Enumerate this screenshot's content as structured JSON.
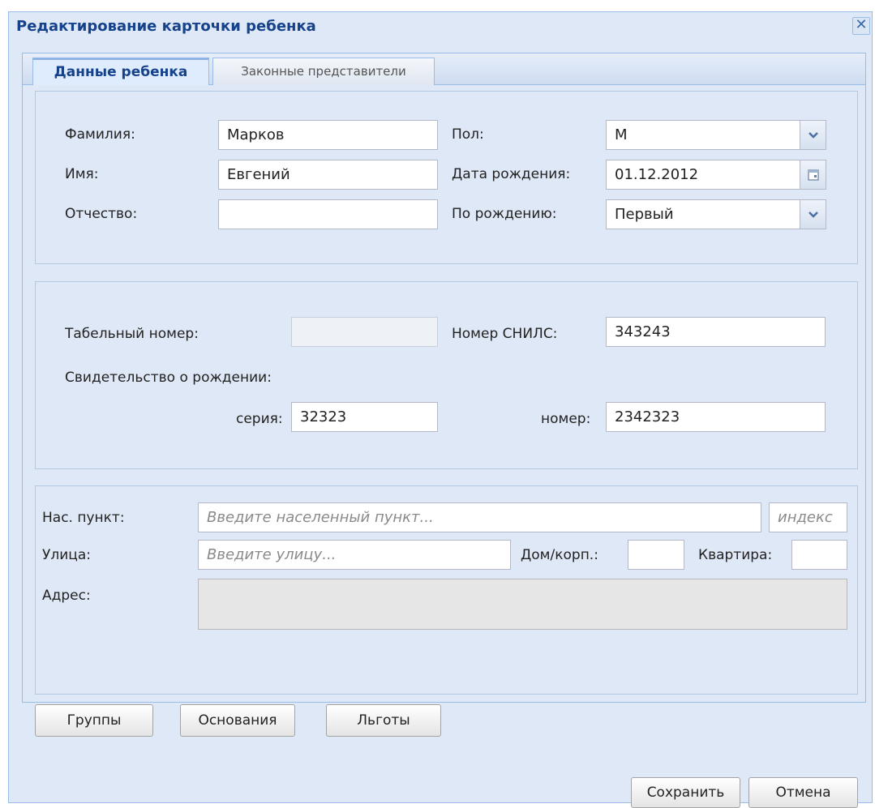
{
  "window": {
    "title": "Редактирование карточки ребенка",
    "close_glyph": "✕"
  },
  "tabs": [
    {
      "label": "Данные ребенка",
      "active": true
    },
    {
      "label": "Законные представители",
      "active": false
    }
  ],
  "personal": {
    "lastname": {
      "label": "Фамилия:",
      "value": "Марков"
    },
    "firstname": {
      "label": "Имя:",
      "value": "Евгений"
    },
    "patronymic": {
      "label": "Отчество:",
      "value": ""
    },
    "gender": {
      "label": "Пол:",
      "value": "М"
    },
    "birthdate": {
      "label": "Дата рождения:",
      "value": "01.12.2012"
    },
    "birth_order": {
      "label": "По рождению:",
      "value": "Первый"
    }
  },
  "ids": {
    "tab_number": {
      "label": "Табельный номер:",
      "value": ""
    },
    "snils": {
      "label": "Номер СНИЛС:",
      "value": "343243"
    },
    "certificate_label": "Свидетельство о рождении:",
    "series": {
      "label": "серия:",
      "value": "32323"
    },
    "number": {
      "label": "номер:",
      "value": "2342323"
    }
  },
  "address": {
    "city": {
      "label": "Нас. пункт:",
      "placeholder": "Введите населенный пункт..."
    },
    "index": {
      "placeholder": "индекс"
    },
    "street": {
      "label": "Улица:",
      "placeholder": "Введите улицу..."
    },
    "house": {
      "label": "Дом/корп.:",
      "value": ""
    },
    "apartment": {
      "label": "Квартира:",
      "value": ""
    },
    "full": {
      "label": "Адрес:",
      "value": ""
    }
  },
  "buttons": {
    "groups": "Группы",
    "grounds": "Основания",
    "benefits": "Льготы",
    "save": "Сохранить",
    "cancel": "Отмена"
  },
  "icons": {
    "dropdown": "chevron-down-icon",
    "calendar": "calendar-icon",
    "close": "close-icon"
  },
  "colors": {
    "title": "#15428b",
    "panel_bg": "#dfe8f6",
    "border": "#99bbe8"
  }
}
